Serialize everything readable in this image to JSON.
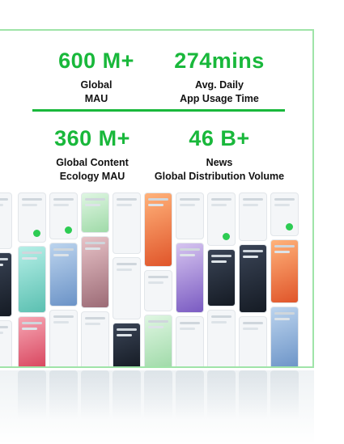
{
  "stats": [
    {
      "value": "600 M+",
      "label_line1": "Global",
      "label_line2": "MAU"
    },
    {
      "value": "274mins",
      "label_line1": "Avg. Daily",
      "label_line2": "App Usage Time"
    },
    {
      "value": "360 M+",
      "label_line1": "Global Content",
      "label_line2": "Ecology MAU"
    },
    {
      "value": "46 B+",
      "label_line1": "News",
      "label_line2": "Global Distribution Volume"
    }
  ],
  "colors": {
    "accent": "#19b83b",
    "panel_border": "#9fe4a8",
    "text": "#111111"
  },
  "icons": [
    "app-screenshot-mosaic"
  ]
}
